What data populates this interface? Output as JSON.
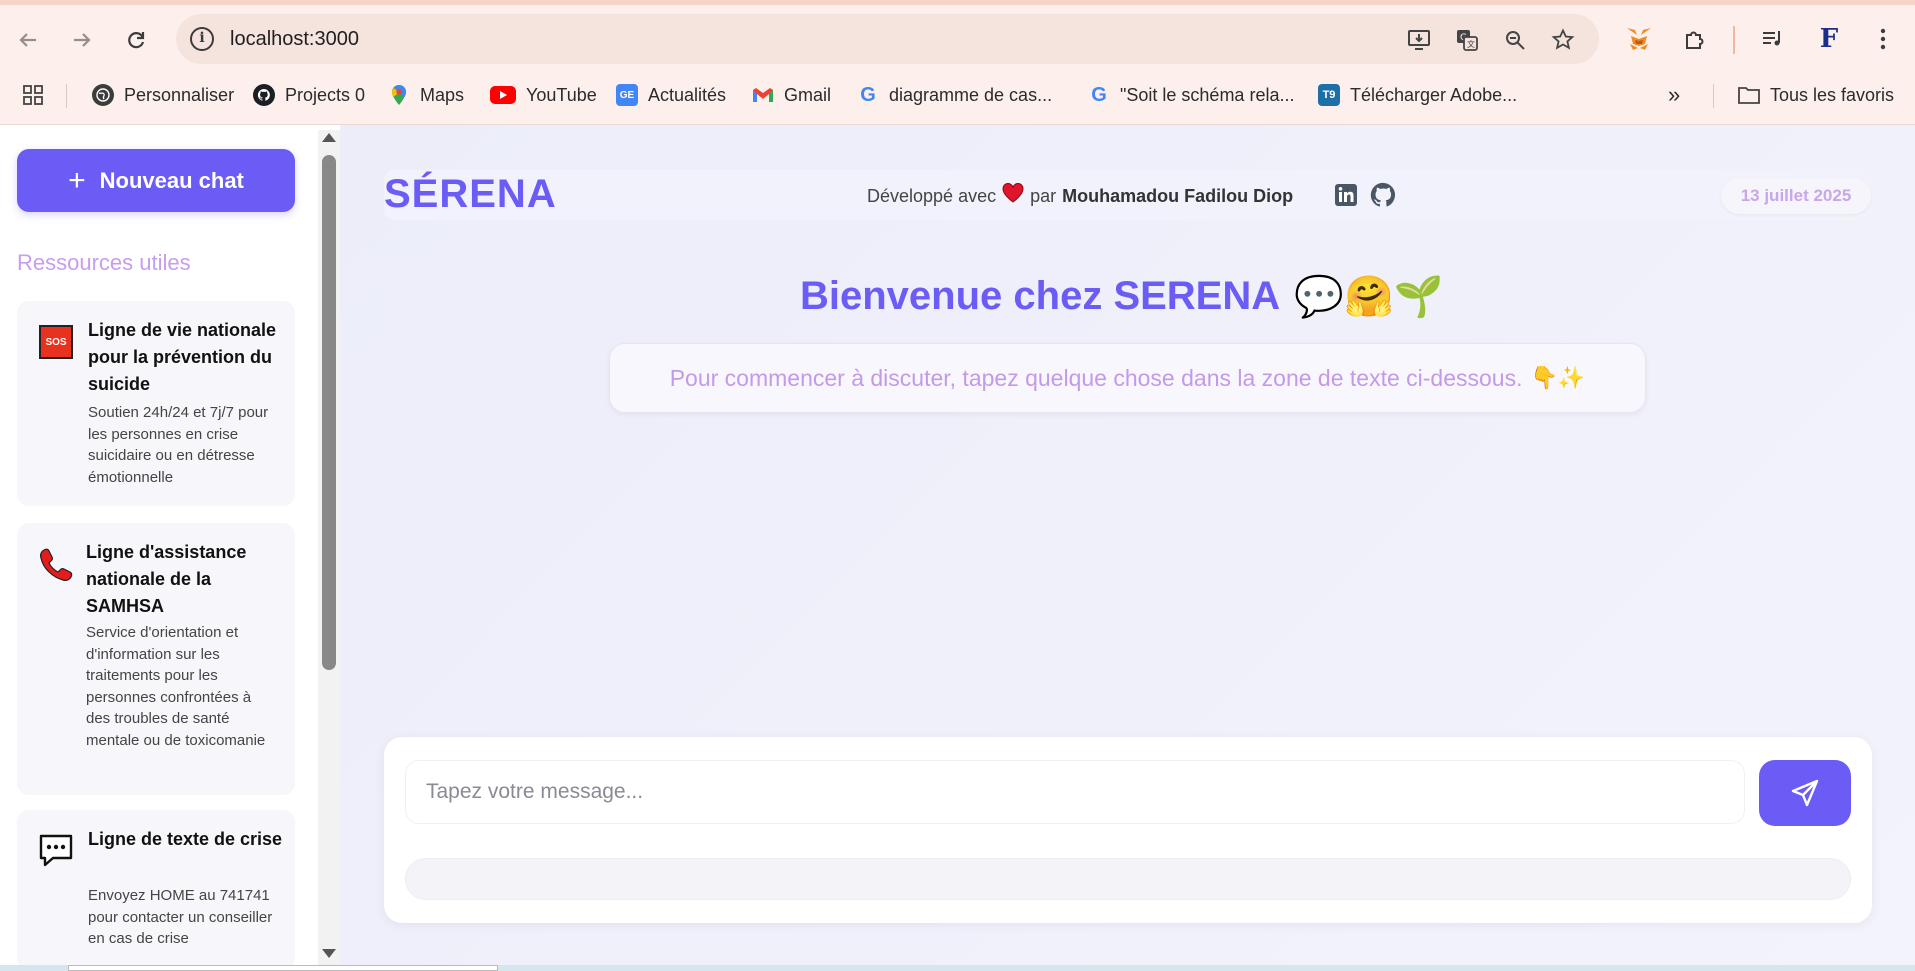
{
  "browser": {
    "url": "localhost:3000",
    "bookmarks": [
      {
        "label": "Personnaliser",
        "icon": "globe-icon"
      },
      {
        "label": "Projects 0",
        "icon": "github-icon"
      },
      {
        "label": "Maps",
        "icon": "maps-pin-icon"
      },
      {
        "label": "YouTube",
        "icon": "youtube-icon"
      },
      {
        "label": "Actualités",
        "icon": "news-icon"
      },
      {
        "label": "Gmail",
        "icon": "gmail-icon"
      },
      {
        "label": "diagramme de cas...",
        "icon": "google-icon"
      },
      {
        "label": "\"Soit le schéma rela...",
        "icon": "google-icon"
      },
      {
        "label": "Télécharger Adobe...",
        "icon": "t9-icon"
      }
    ],
    "all_favorites": "Tous les favoris",
    "more_label": "»",
    "profile_initial": "F"
  },
  "sidebar": {
    "new_chat_label": "Nouveau chat",
    "resources_title": "Ressources utiles",
    "resources": [
      {
        "icon": "sos-icon",
        "icon_text": "SOS",
        "title": "Ligne de vie nationale pour la prévention du suicide",
        "description": "Soutien 24h/24 et 7j/7 pour les personnes en crise suicidaire ou en détresse émotionnelle"
      },
      {
        "icon": "phone-icon",
        "title": "Ligne d'assistance nationale de la SAMHSA",
        "description": "Service d'orientation et d'information sur les traitements pour les personnes confrontées à des troubles de santé mentale ou de toxicomanie"
      },
      {
        "icon": "chat-bubble-icon",
        "title": "Ligne de texte de crise",
        "description": "Envoyez HOME au 741741 pour contacter un conseiller en cas de crise"
      }
    ]
  },
  "header": {
    "logo": "SÉRENA",
    "developed_with": "Développé avec",
    "by": "par",
    "author": "Mouhamadou Fadilou Diop",
    "date": "13 juillet 2025"
  },
  "welcome": {
    "title": "Bienvenue chez SERENA",
    "emojis": "💬🤗🌱",
    "hint": "Pour commencer à discuter, tapez quelque chose dans la zone de texte ci-dessous.",
    "hint_emojis": "👇✨"
  },
  "composer": {
    "placeholder": "Tapez votre message..."
  },
  "colors": {
    "accent": "#6c5cf6",
    "lilac": "#c79df0"
  }
}
